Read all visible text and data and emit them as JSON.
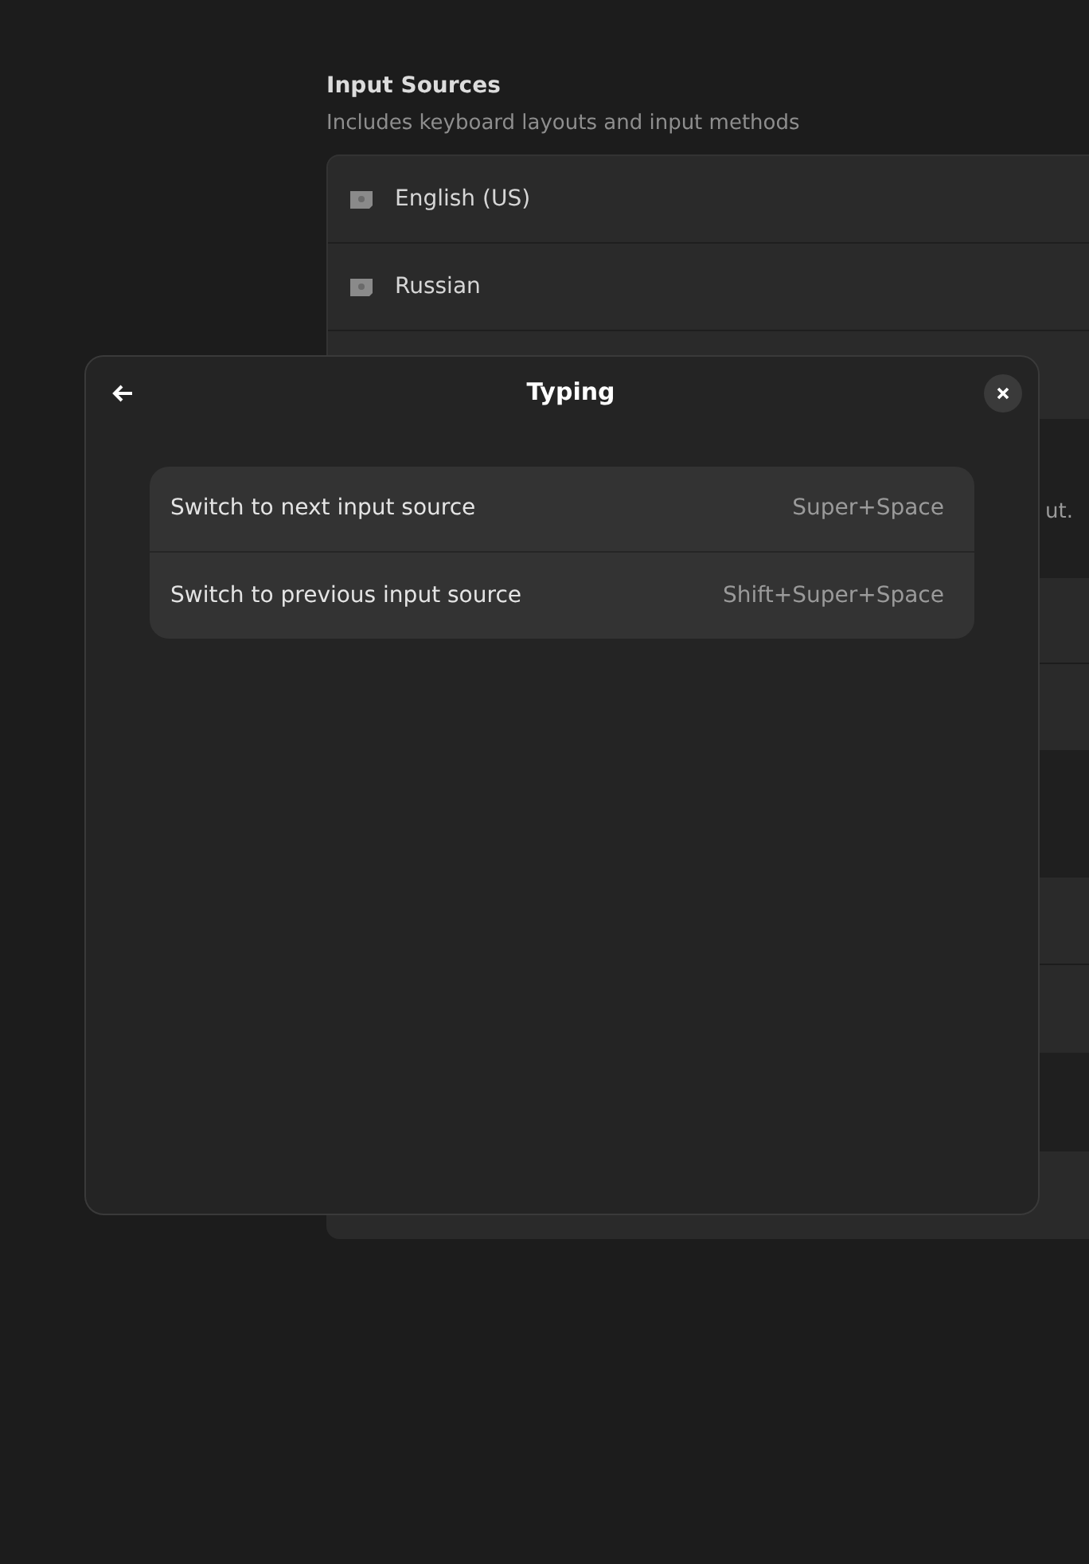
{
  "background_page": {
    "section": {
      "heading": "Input Sources",
      "description": "Includes keyboard layouts and input methods"
    },
    "input_sources": [
      {
        "label": "English (US)"
      },
      {
        "label": "Russian"
      }
    ],
    "partial_text": "ut."
  },
  "dialog": {
    "title": "Typing",
    "shortcuts": [
      {
        "label": "Switch to next input source",
        "accelerator": "Super+Space"
      },
      {
        "label": "Switch to previous input source",
        "accelerator": "Shift+Super+Space"
      }
    ]
  }
}
